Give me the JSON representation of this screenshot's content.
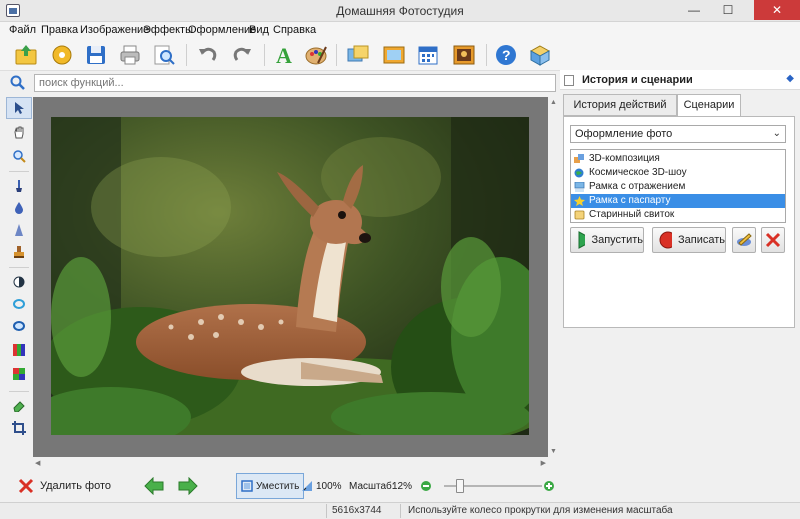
{
  "window": {
    "title": "Домашняя Фотостудия"
  },
  "window_controls": {
    "minimize": "—",
    "maximize": "☐",
    "close": "✕"
  },
  "menu": [
    "Файл",
    "Правка",
    "Изображение",
    "Эффекты",
    "Оформление",
    "Вид",
    "Справка"
  ],
  "toolbar_icons": [
    "open-icon",
    "album-icon",
    "save-icon",
    "print-icon",
    "preview-icon",
    "undo-icon",
    "redo-icon",
    "text-icon",
    "palette-icon",
    "photo-frame-icon",
    "frame-icon",
    "calendar-icon",
    "collage-icon",
    "help-icon",
    "box-icon"
  ],
  "search": {
    "placeholder": "поиск функций..."
  },
  "left_tools": [
    "pointer-icon",
    "hand-icon",
    "zoom-icon",
    "brush-icon",
    "drop-icon",
    "cone-icon",
    "stamp-icon",
    "contrast-icon",
    "circle-icon",
    "ring-icon",
    "levels-icon",
    "color-balance-icon",
    "eraser-icon",
    "crop-icon"
  ],
  "panel": {
    "title": "История и сценарии",
    "tabs": [
      "История действий",
      "Сценарии"
    ],
    "active_tab": "Сценарии",
    "select_value": "Оформление фото",
    "items": [
      "3D-композиция",
      "Космическое 3D-шоу",
      "Рамка с отражением",
      "Рамка с паспарту",
      "Старинный свиток"
    ],
    "selected_index": 3,
    "run_label": "Запустить",
    "record_label": "Записать"
  },
  "bottom": {
    "delete_label": "Удалить фото",
    "fit_label": "Уместить",
    "zoom100_label": "100%",
    "scale_label": "Масштаб:",
    "scale_value": "12%",
    "zoom_fraction": 0.12
  },
  "status": {
    "dimensions": "5616x3744",
    "hint": "Используйте колесо прокрутки для изменения масштаба"
  },
  "colors": {
    "accent": "#3a8ee6",
    "canvas": "#777777",
    "run_green": "#2ea44f",
    "record_red": "#d93025"
  }
}
